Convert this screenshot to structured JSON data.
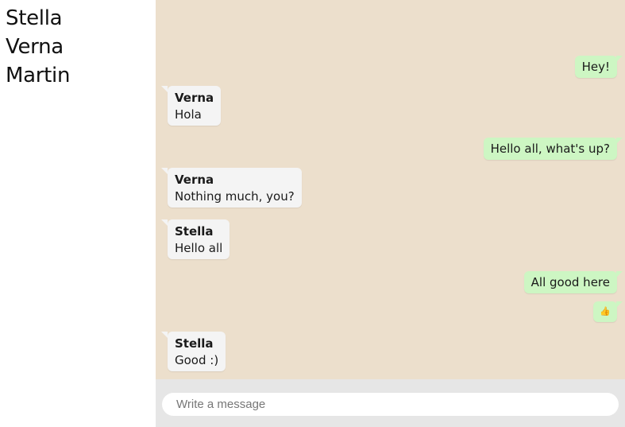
{
  "contacts": [
    "Stella",
    "Verna",
    "Martin"
  ],
  "messages": [
    {
      "direction": "out",
      "text": "Hey!"
    },
    {
      "direction": "in",
      "sender": "Verna",
      "text": "Hola"
    },
    {
      "direction": "out",
      "text": "Hello all, what's up?"
    },
    {
      "direction": "in",
      "sender": "Verna",
      "text": "Nothing much, you?"
    },
    {
      "direction": "in",
      "sender": "Stella",
      "text": "Hello all"
    },
    {
      "direction": "out",
      "text": "All good here"
    },
    {
      "direction": "out",
      "text": "👍"
    },
    {
      "direction": "in",
      "sender": "Stella",
      "text": "Good :)"
    }
  ],
  "composer": {
    "placeholder": "Write a message"
  },
  "colors": {
    "chat_background": "#ecdfcc",
    "outgoing_bubble": "#cdf6c3",
    "incoming_bubble": "#f4f4f4",
    "composer_bar": "#e6e6e6"
  }
}
